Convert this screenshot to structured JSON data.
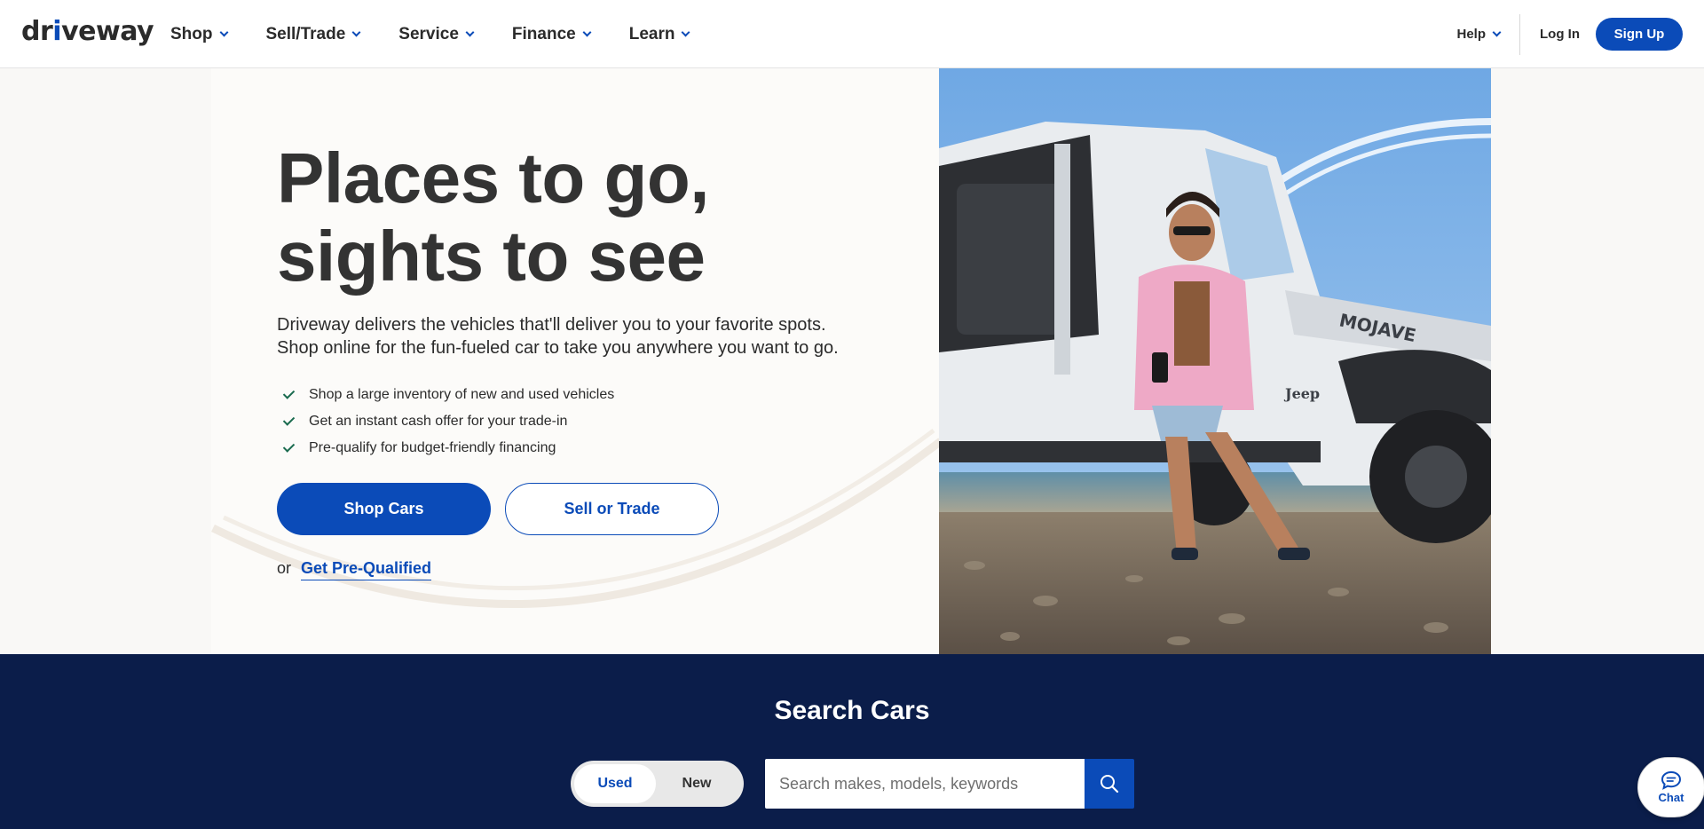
{
  "brand": {
    "logo_text_pre": "dr",
    "logo_text_i": "i",
    "logo_text_post": "veway",
    "accent": "#0b4bb8",
    "navy": "#0b1d4a"
  },
  "nav": {
    "items": [
      {
        "label": "Shop"
      },
      {
        "label": "Sell/Trade"
      },
      {
        "label": "Service"
      },
      {
        "label": "Finance"
      },
      {
        "label": "Learn"
      }
    ],
    "help": "Help",
    "login": "Log In",
    "signup": "Sign Up"
  },
  "hero": {
    "title": "Places to go, sights to see",
    "subtitle": "Driveway delivers the vehicles that'll deliver you to your favorite spots. Shop online for the fun-fueled car to take you anywhere you want to go.",
    "checks": [
      "Shop a large inventory of new and used vehicles",
      "Get an instant cash offer for your trade-in",
      "Pre-qualify for budget-friendly financing"
    ],
    "primary_cta": "Shop Cars",
    "secondary_cta": "Sell or Trade",
    "or_text": "or",
    "prequal_link": "Get Pre-Qualified"
  },
  "photo": {
    "badge_mojave": "MOJAVE",
    "badge_jeep": "Jeep"
  },
  "search": {
    "title": "Search Cars",
    "toggle": [
      {
        "label": "Used",
        "active": true
      },
      {
        "label": "New",
        "active": false
      }
    ],
    "placeholder": "Search makes, models, keywords"
  },
  "chat": {
    "label": "Chat"
  }
}
